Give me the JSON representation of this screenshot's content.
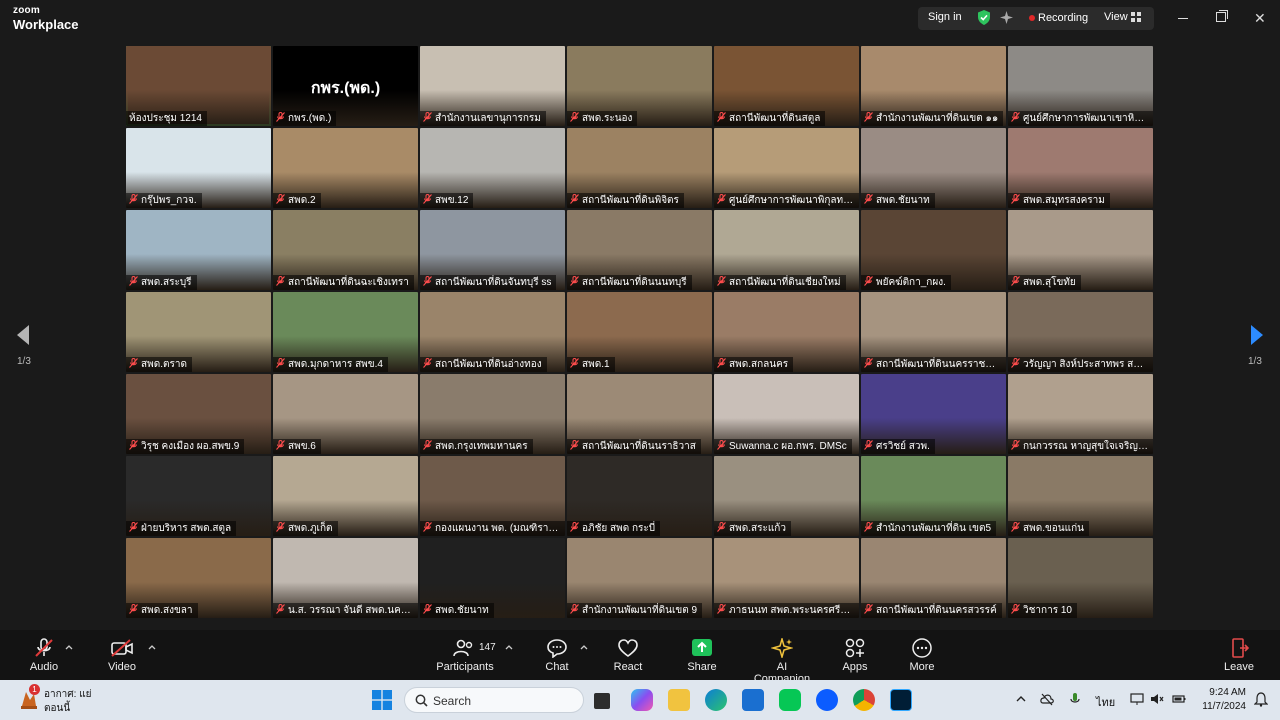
{
  "app": {
    "logo_top": "zoom",
    "logo_bottom": "Workplace"
  },
  "titlebar": {
    "signin": "Sign in",
    "recording": "Recording",
    "view": "View",
    "icons": [
      "shield-check-icon",
      "sparkle-icon",
      "grid-view-icon",
      "minimize-icon",
      "maximize-icon",
      "close-icon"
    ]
  },
  "nav": {
    "page_left": "1/3",
    "page_right": "1/3"
  },
  "tiles": [
    {
      "name": "ห้องประชุม 1214",
      "muted": false,
      "active": true,
      "bg": "#6b4a35"
    },
    {
      "name": "กพร.(พด.)",
      "muted": true,
      "bg": "#000000",
      "big": "กพร.(พด.)"
    },
    {
      "name": "สำนักงานเลขานุการกรม",
      "muted": true,
      "bg": "#c8bfb2"
    },
    {
      "name": "สพด.ระนอง",
      "muted": true,
      "bg": "#8a7b5e"
    },
    {
      "name": "สถานีพัฒนาที่ดินสตูล",
      "muted": true,
      "bg": "#7a5434"
    },
    {
      "name": "สำนักงานพัฒนาที่ดินเขต ๑๑",
      "muted": true,
      "bg": "#a88a6c"
    },
    {
      "name": "ศูนย์ศึกษาการพัฒนาเขาหินซ้อน",
      "muted": true,
      "bg": "#8d8a86"
    },
    {
      "name": "กรุ๊ปพร_กวจ.",
      "muted": true,
      "bg": "#d9e4ea"
    },
    {
      "name": "สพด.2",
      "muted": true,
      "bg": "#a98b67"
    },
    {
      "name": "สพข.12",
      "muted": true,
      "bg": "#b7b6b2"
    },
    {
      "name": "สถานีพัฒนาที่ดินพิจิตร",
      "muted": true,
      "bg": "#9c8262"
    },
    {
      "name": "ศูนย์ศึกษาการพัฒนาพิกุลทอง",
      "muted": true,
      "bg": "#b69c78"
    },
    {
      "name": "สพด.ชัยนาท",
      "muted": true,
      "bg": "#9a8c84"
    },
    {
      "name": "สพด.สมุทรสงคราม",
      "muted": true,
      "bg": "#9e7a70"
    },
    {
      "name": "สพด.สระบุรี",
      "muted": true,
      "bg": "#9fb5c4"
    },
    {
      "name": "สถานีพัฒนาที่ดินฉะเชิงเทรา",
      "muted": true,
      "bg": "#8a7f63"
    },
    {
      "name": "สถานีพัฒนาที่ดินจันทบุรี ss",
      "muted": true,
      "bg": "#8e96a0"
    },
    {
      "name": "สถานีพัฒนาที่ดินนนทบุรี",
      "muted": true,
      "bg": "#8a7a66"
    },
    {
      "name": "สถานีพัฒนาที่ดินเชียงใหม่",
      "muted": true,
      "bg": "#b0a894"
    },
    {
      "name": "พยัคฆ์ติกา_กผง.",
      "muted": true,
      "bg": "#5a4535"
    },
    {
      "name": "สพด.สุโขทัย",
      "muted": true,
      "bg": "#a99a8a"
    },
    {
      "name": "สพด.ตราด",
      "muted": true,
      "bg": "#a09576"
    },
    {
      "name": "สพด.มุกดาหาร สพข.4",
      "muted": true,
      "bg": "#6a8a5a"
    },
    {
      "name": "สถานีพัฒนาที่ดินอ่างทอง",
      "muted": true,
      "bg": "#9a846a"
    },
    {
      "name": "สพด.1",
      "muted": true,
      "bg": "#8c6a4e"
    },
    {
      "name": "สพด.สกลนคร",
      "muted": true,
      "bg": "#9a7c66"
    },
    {
      "name": "สถานีพัฒนาที่ดินนครราชสีมา",
      "muted": true,
      "bg": "#a69480"
    },
    {
      "name": "วรัญญา สิงห์ประสาทพร สพด.ชุมพร",
      "muted": true,
      "bg": "#7a6a5a"
    },
    {
      "name": "วิรุช คงเมือง ผอ.สพข.9",
      "muted": true,
      "bg": "#6a5040"
    },
    {
      "name": "สพข.6",
      "muted": true,
      "bg": "#a69684"
    },
    {
      "name": "สพด.กรุงเทพมหานคร",
      "muted": true,
      "bg": "#8a7c6c"
    },
    {
      "name": "สถานีพัฒนาที่ดินนราธิวาส",
      "muted": true,
      "bg": "#9c8a76"
    },
    {
      "name": "Suwanna.c ผอ.กพร. DMSc",
      "muted": true,
      "bg": "#c9bfb8"
    },
    {
      "name": "ศรวิชย์ สวพ.",
      "muted": true,
      "bg": "#4a3f8a"
    },
    {
      "name": "กนกวรรณ หาญสุขใจเจริญ (สพด.)",
      "muted": true,
      "bg": "#b0a08e"
    },
    {
      "name": "ฝ่ายบริหาร สพด.สตูล",
      "muted": true,
      "bg": "#2a2a2a"
    },
    {
      "name": "สพด.ภูเก็ต",
      "muted": true,
      "bg": "#b5a892"
    },
    {
      "name": "กองแผนงาน พด. (มณฑิรา พรหมแสง)",
      "muted": true,
      "bg": "#6e5a4a"
    },
    {
      "name": "อภิชัย สพด กระบี่",
      "muted": true,
      "bg": "#2e2a26"
    },
    {
      "name": "สพด.สระแก้ว",
      "muted": true,
      "bg": "#9a9080"
    },
    {
      "name": "สำนักงานพัฒนาที่ดิน เขต5",
      "muted": true,
      "bg": "#6a8a5a"
    },
    {
      "name": "สพด.ขอนแก่น",
      "muted": true,
      "bg": "#8a7a66"
    },
    {
      "name": "สพด.สงขลา",
      "muted": true,
      "bg": "#8a6a4a"
    },
    {
      "name": "น.ส. วรรณา จันดี สพด.นครนายก",
      "muted": true,
      "bg": "#c0b8b0"
    },
    {
      "name": "สพด.ชัยนาท",
      "muted": true,
      "bg": "#202020"
    },
    {
      "name": "สำนักงานพัฒนาที่ดินเขต 9",
      "muted": true,
      "bg": "#9a8670"
    },
    {
      "name": "ภาธนนท สพด.พระนครศรีอยุธยา",
      "muted": true,
      "bg": "#a8927a"
    },
    {
      "name": "สถานีพัฒนาที่ดินนครสวรรค์",
      "muted": true,
      "bg": "#9a8672"
    },
    {
      "name": "วิชาการ 10",
      "muted": true,
      "bg": "#6a6050"
    }
  ],
  "toolbar": {
    "audio": "Audio",
    "video": "Video",
    "participants": "Participants",
    "participants_count": "147",
    "chat": "Chat",
    "react": "React",
    "share": "Share",
    "ai_companion": "AI Companion",
    "apps": "Apps",
    "more": "More",
    "leave": "Leave"
  },
  "taskbar": {
    "weather_line1": "อากาศ: แย่",
    "weather_line2": "ตอนนี้",
    "weather_badge": "1",
    "search_placeholder": "Search",
    "language": "ไทย",
    "time": "9:24 AM",
    "date": "11/7/2024",
    "apps": [
      "file-explorer-icon",
      "copilot-icon",
      "folder-icon",
      "edge-icon",
      "store-icon",
      "line-icon",
      "zoom-icon",
      "chrome-icon",
      "photoshop-icon"
    ]
  },
  "colors": {
    "active_border": "#3fd66b",
    "share_green": "#1fc25a",
    "recording_red": "#e02828",
    "nav_blue": "#2d8cff"
  }
}
